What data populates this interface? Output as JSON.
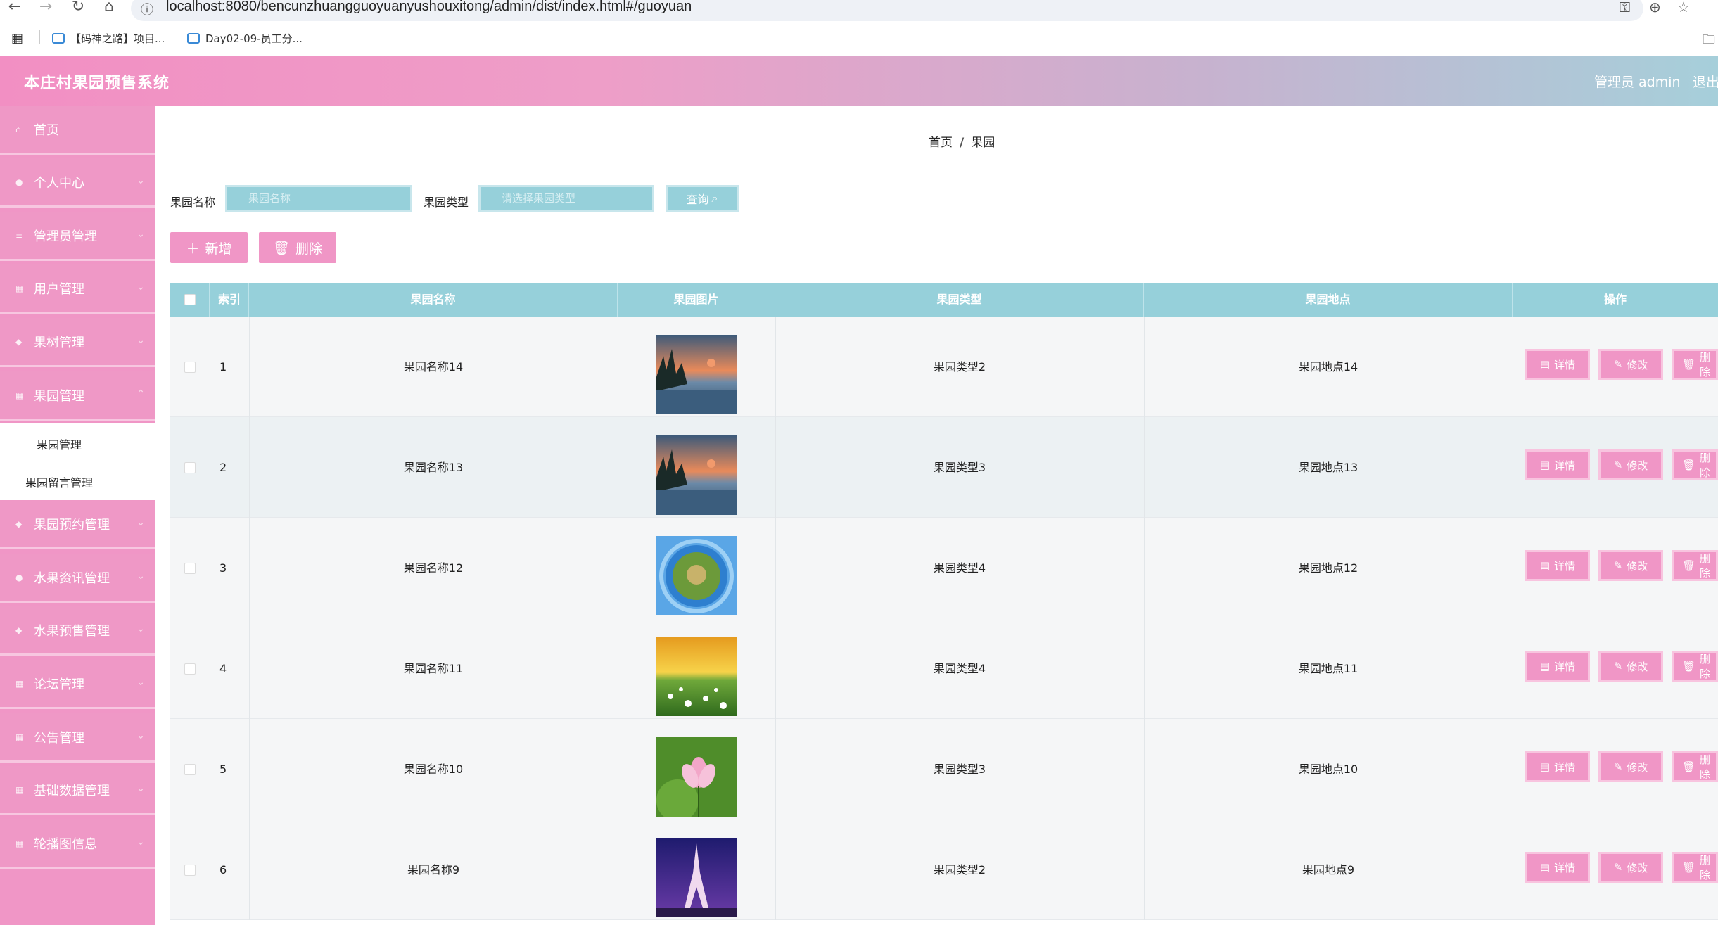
{
  "browser": {
    "url": "localhost:8080/bencunzhuangguoyuanyushouxitong/admin/dist/index.html#/guoyuan",
    "bookmarks": [
      "【码神之路】项目...",
      "Day02-09-员工分..."
    ]
  },
  "header": {
    "title": "本庄村果园预售系统",
    "user": "管理员 admin",
    "logout": "退出"
  },
  "sidebar": {
    "items": [
      {
        "label": "首页"
      },
      {
        "label": "个人中心"
      },
      {
        "label": "管理员管理"
      },
      {
        "label": "用户管理"
      },
      {
        "label": "果树管理"
      },
      {
        "label": "果园管理"
      },
      {
        "label": "果园预约管理"
      },
      {
        "label": "水果资讯管理"
      },
      {
        "label": "水果预售管理"
      },
      {
        "label": "论坛管理"
      },
      {
        "label": "公告管理"
      },
      {
        "label": "基础数据管理"
      },
      {
        "label": "轮播图信息"
      }
    ],
    "submenu": [
      "果园管理",
      "果园留言管理"
    ]
  },
  "breadcrumb": {
    "home": "首页",
    "current": "果园"
  },
  "filters": {
    "name_label": "果园名称",
    "name_placeholder": "果园名称",
    "type_label": "果园类型",
    "type_placeholder": "请选择果园类型",
    "query_label": "查询"
  },
  "toolbar": {
    "add_label": "新增",
    "delete_label": "删除"
  },
  "table": {
    "columns": [
      "索引",
      "果园名称",
      "果园图片",
      "果园类型",
      "果园地点",
      "操作"
    ],
    "actions": {
      "detail": "详情",
      "edit": "修改",
      "delete": "删除"
    },
    "rows": [
      {
        "index": "1",
        "name": "果园名称14",
        "type": "果园类型2",
        "location": "果园地点14",
        "image": "lake-sunset"
      },
      {
        "index": "2",
        "name": "果园名称13",
        "type": "果园类型3",
        "location": "果园地点13",
        "image": "lake-sunset"
      },
      {
        "index": "3",
        "name": "果园名称12",
        "type": "果园类型4",
        "location": "果园地点12",
        "image": "tiny-planet"
      },
      {
        "index": "4",
        "name": "果园名称11",
        "type": "果园类型4",
        "location": "果园地点11",
        "image": "flower-meadow"
      },
      {
        "index": "5",
        "name": "果园名称10",
        "type": "果园类型3",
        "location": "果园地点10",
        "image": "lotus-flower"
      },
      {
        "index": "6",
        "name": "果园名称9",
        "type": "果园类型2",
        "location": "果园地点9",
        "image": "eiffel-tower"
      }
    ]
  },
  "colors": {
    "primary_pink": "#f096c6",
    "teal": "#96d0da"
  }
}
